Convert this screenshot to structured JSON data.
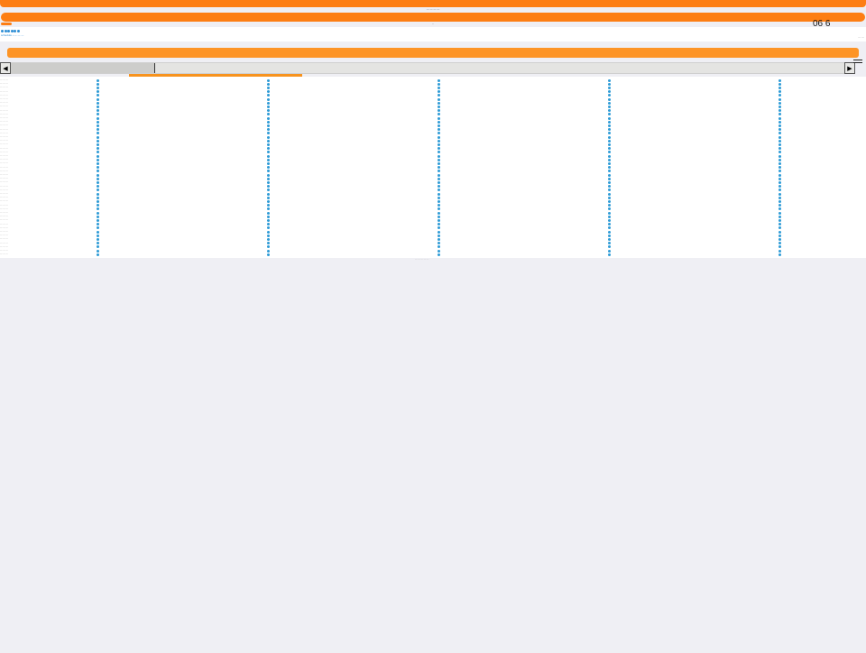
{
  "header": {
    "caption": "— — — —",
    "center_mark": "–",
    "clock": "06 6"
  },
  "toolbar": {
    "dot_count": 6,
    "breadcrumb": "schedule › — — —",
    "right_label": "— —"
  },
  "scrollbar": {
    "left_arrow": "◀",
    "right_arrow": "▶"
  },
  "grid": {
    "columns": 6,
    "rows": 47,
    "row_label": "— — —",
    "dot_color": "#2e9bd6"
  },
  "footer": {
    "text": "— — — — —"
  },
  "colors": {
    "accent": "#fd7e14",
    "band": "#fd9426",
    "link": "#2f8fd6",
    "background": "#efeff4"
  }
}
